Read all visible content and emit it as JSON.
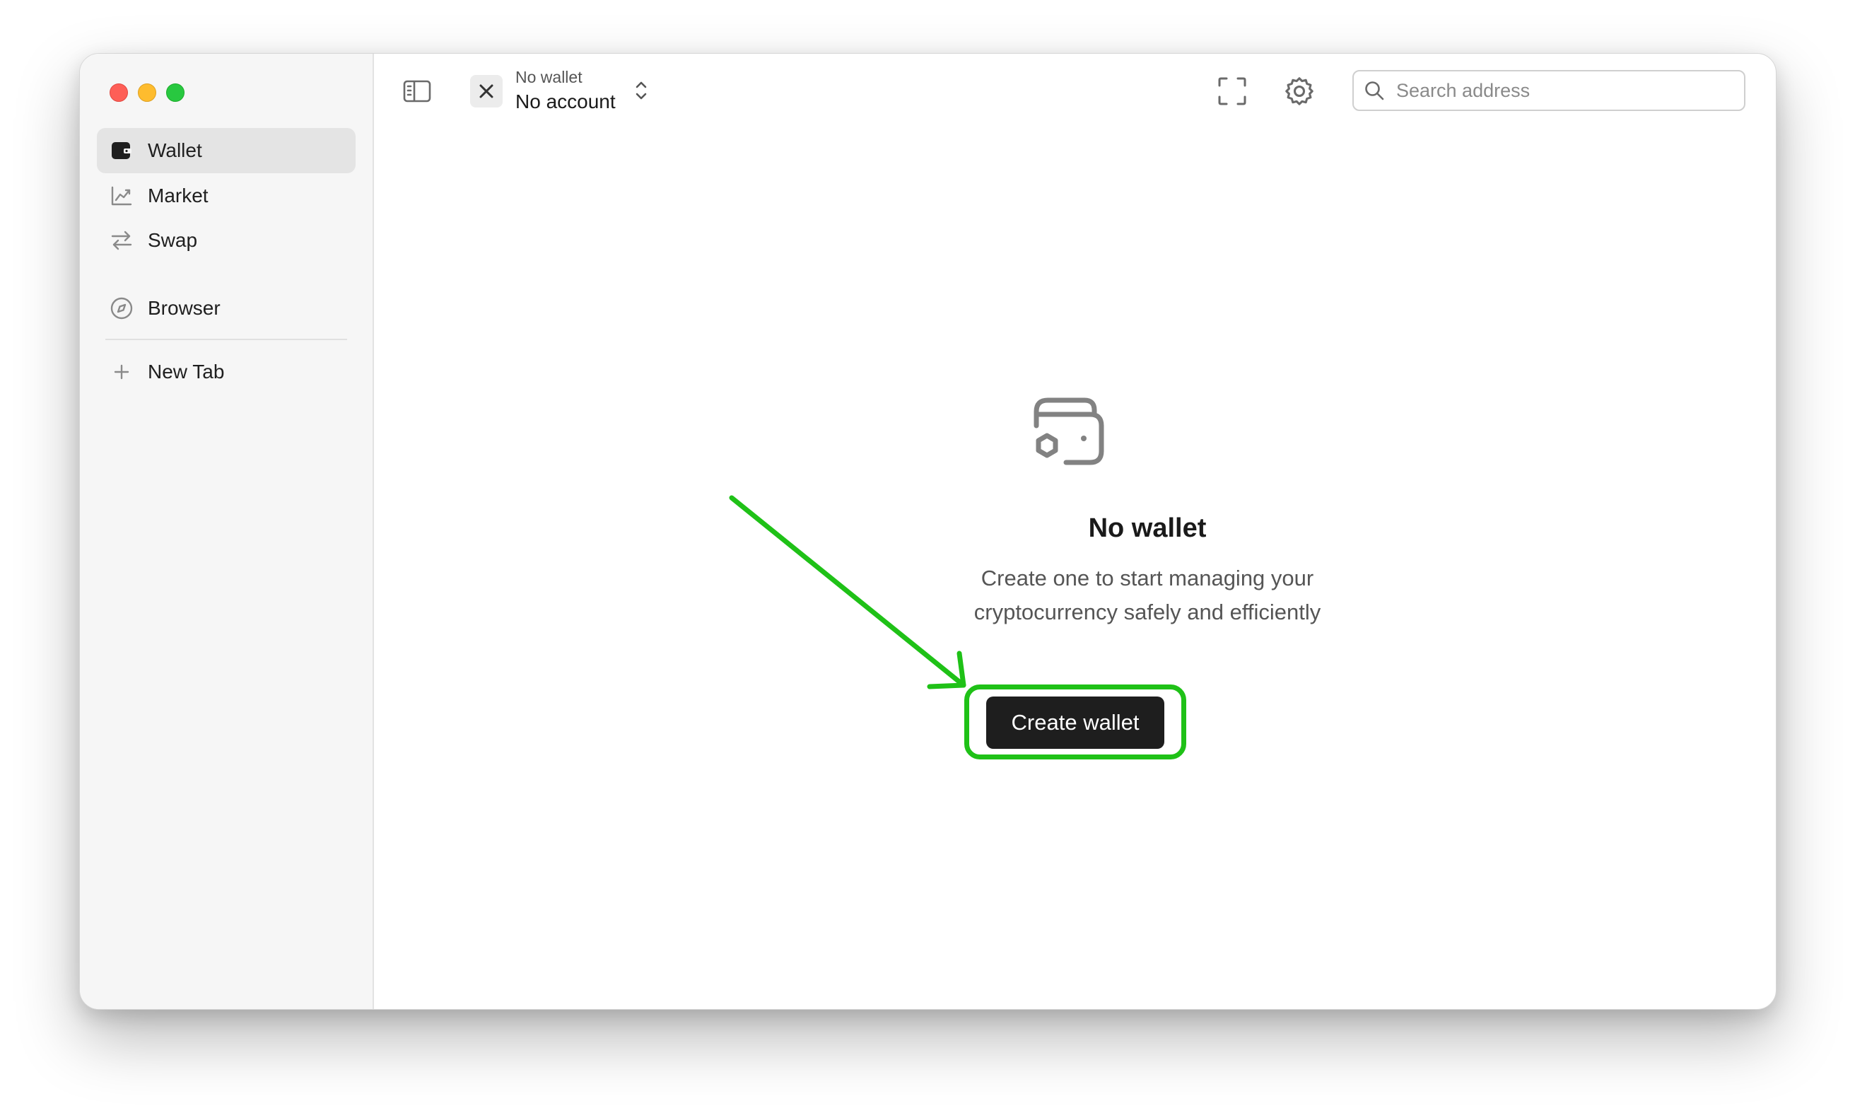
{
  "sidebar": {
    "items": [
      {
        "label": "Wallet",
        "icon": "wallet-icon",
        "active": true
      },
      {
        "label": "Market",
        "icon": "chart-icon"
      },
      {
        "label": "Swap",
        "icon": "swap-arrows-icon"
      },
      {
        "label": "Browser",
        "icon": "compass-icon"
      },
      {
        "label": "New Tab",
        "icon": "plus-icon"
      }
    ]
  },
  "header": {
    "wallet_label": "No wallet",
    "account_label": "No account",
    "search_placeholder": "Search address"
  },
  "empty_state": {
    "icon": "wallet-icon",
    "title": "No wallet",
    "description": "Create one to start managing your cryptocurrency safely and efficiently",
    "button_label": "Create wallet"
  },
  "annotation": {
    "color": "#1fc117"
  }
}
